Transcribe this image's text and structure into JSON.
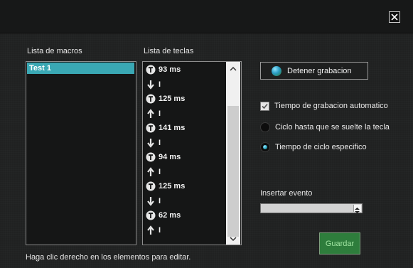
{
  "window": {
    "close_icon": "close-icon"
  },
  "macros": {
    "header": "Lista de macros",
    "items": [
      "Test 1"
    ]
  },
  "keys": {
    "header": "Lista de teclas",
    "rows": [
      {
        "icon": "timer-icon",
        "text": "93 ms"
      },
      {
        "icon": "arrow-down-icon",
        "text": "I"
      },
      {
        "icon": "timer-icon",
        "text": "125 ms"
      },
      {
        "icon": "arrow-up-icon",
        "text": "I"
      },
      {
        "icon": "timer-icon",
        "text": "141 ms"
      },
      {
        "icon": "arrow-down-icon",
        "text": "I"
      },
      {
        "icon": "timer-icon",
        "text": "94 ms"
      },
      {
        "icon": "arrow-up-icon",
        "text": "I"
      },
      {
        "icon": "timer-icon",
        "text": "125 ms"
      },
      {
        "icon": "arrow-down-icon",
        "text": "I"
      },
      {
        "icon": "timer-icon",
        "text": "62 ms"
      },
      {
        "icon": "arrow-up-icon",
        "text": "I"
      }
    ]
  },
  "record": {
    "stop_label": "Detener grabacion"
  },
  "options": {
    "auto_time": {
      "label": "Tiempo de grabacion automatico",
      "checked": true
    },
    "cycle_until_release": {
      "label": "Ciclo hasta que se suelte la tecla",
      "selected": false
    },
    "specific_cycle_time": {
      "label": "Tiempo de ciclo especifico",
      "selected": true
    }
  },
  "insert_event": {
    "label": "Insertar evento",
    "value": ""
  },
  "save_label": "Guardar",
  "hint": "Haga clic derecho en los elementos para editar.",
  "colors": {
    "accent": "#3aa8b4",
    "save": "#2e7d3c",
    "save_text": "#9fe3a0"
  }
}
